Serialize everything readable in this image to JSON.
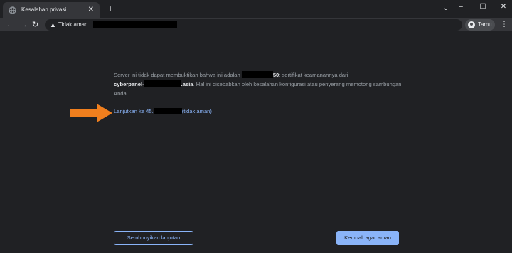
{
  "tab": {
    "title": "Kesalahan privasi",
    "close": "✕"
  },
  "new_tab": "+",
  "window": {
    "tab_search": "⌄",
    "minimize": "–",
    "maximize": "☐",
    "close": "✕"
  },
  "toolbar": {
    "back": "←",
    "forward": "→",
    "reload": "↻",
    "menu": "⋮"
  },
  "omnibox": {
    "warning": "▲",
    "security_label": "Tidak aman"
  },
  "profile": {
    "label": "Tamu"
  },
  "content": {
    "line1_start": "Server ini tidak dapat membuktikan bahwa ini adalah ",
    "line1_bold_end": "50",
    "line1_rest": "; sertifikat keamanannya dari",
    "cert_bold_start": "cyberpanel-",
    "cert_bold_end": ".asia",
    "line2_rest": ". Hal ini disebabkan oleh kesalahan konfigurasi atau penyerang memotong sambungan Anda.",
    "proceed_start": "Lanjutkan ke 45.",
    "proceed_end": "(tidak aman)"
  },
  "buttons": {
    "hide_advanced": "Sembunyikan lanjutan",
    "back_to_safety": "Kembali agar aman"
  },
  "colors": {
    "background": "#202124",
    "link": "#8ab4f8",
    "arrow": "#f07f1e"
  }
}
